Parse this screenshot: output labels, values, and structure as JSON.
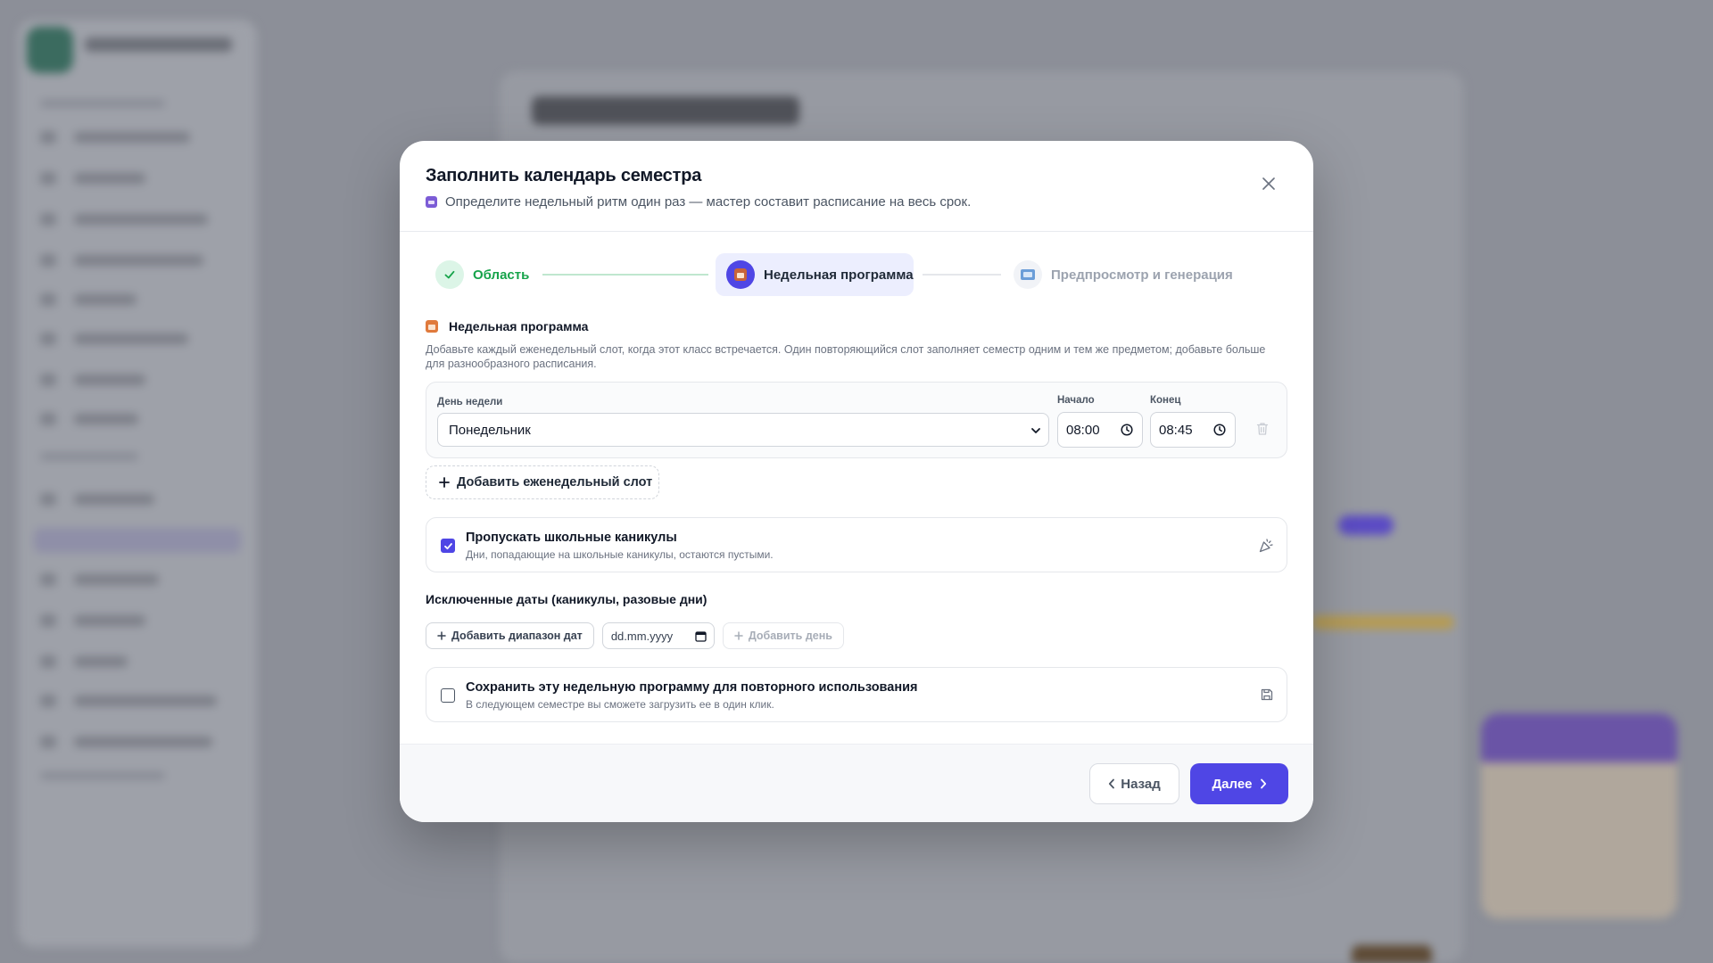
{
  "modal": {
    "title": "Заполнить календарь семестра",
    "subtitle": "Определите недельный ритм один раз — мастер составит расписание на весь срок."
  },
  "stepper": {
    "steps": [
      {
        "label": "Область",
        "state": "done"
      },
      {
        "label": "Недельная программа",
        "state": "active"
      },
      {
        "label": "Предпросмотр и генерация",
        "state": "upcoming"
      }
    ]
  },
  "weekly": {
    "title": "Недельная программа",
    "description": "Добавьте каждый еженедельный слот, когда этот класс встречается. Один повторяющийся слот заполняет семестр одним и тем же предметом; добавьте больше для разнообразного расписания.",
    "day_label": "День недели",
    "day_value": "Понедельник",
    "start_label": "Начало",
    "start_value": "08:00",
    "end_label": "Конец",
    "end_value": "08:45",
    "add_slot_label": "Добавить еженедельный слот"
  },
  "skip_holidays": {
    "title": "Пропускать школьные каникулы",
    "description": "Дни, попадающие на школьные каникулы, остаются пустыми.",
    "checked": true
  },
  "excluded": {
    "title": "Исключенные даты (каникулы, разовые дни)",
    "add_range_label": "Добавить диапазон дат",
    "date_placeholder": "dd.mm.yyyy",
    "add_day_label": "Добавить день"
  },
  "save_program": {
    "title": "Сохранить эту недельную программу для повторного использования",
    "description": "В следующем семестре вы сможете загрузить ее в один клик.",
    "checked": false
  },
  "footer": {
    "back_label": "Назад",
    "next_label": "Далее"
  },
  "colors": {
    "accent": "#4f46e5",
    "success": "#16a34a"
  }
}
